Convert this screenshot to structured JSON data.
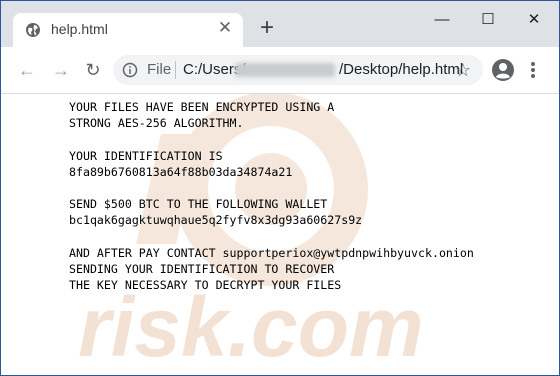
{
  "tab": {
    "title": "help.html",
    "close_glyph": "✕",
    "icon": "globe-icon"
  },
  "new_tab_glyph": "+",
  "window_controls": {
    "minimize": "—",
    "maximize": "☐",
    "close": "✕"
  },
  "toolbar": {
    "back_glyph": "←",
    "forward_glyph": "→",
    "reload_glyph": "↻",
    "scheme_label": "File",
    "url_prefix": "C:/Users/",
    "url_suffix": "/Desktop/help.html",
    "star_glyph": "☆"
  },
  "watermark": {
    "text": "risk.com",
    "color": "#f3e2d4"
  },
  "note": {
    "line1": "YOUR FILES HAVE BEEN ENCRYPTED USING A",
    "line2": "STRONG AES-256 ALGORITHM.",
    "line3": "YOUR IDENTIFICATION IS",
    "line4": "8fa89b6760813a64f88b03da34874a21",
    "line5": "SEND $500 BTC TO THE FOLLOWING WALLET",
    "line6": "bc1qak6gagktuwqhaue5q2fyfv8x3dg93a60627s9z",
    "line7": "AND AFTER PAY CONTACT supportperiox@ywtpdnpwihbyuvck.onion",
    "line8": "SENDING YOUR IDENTIFICATION TO RECOVER",
    "line9": "THE KEY NECESSARY TO DECRYPT YOUR FILES"
  },
  "colors": {
    "frame": "#2b579a",
    "tabbar": "#dee1e6",
    "omnibox": "#f1f3f4"
  }
}
